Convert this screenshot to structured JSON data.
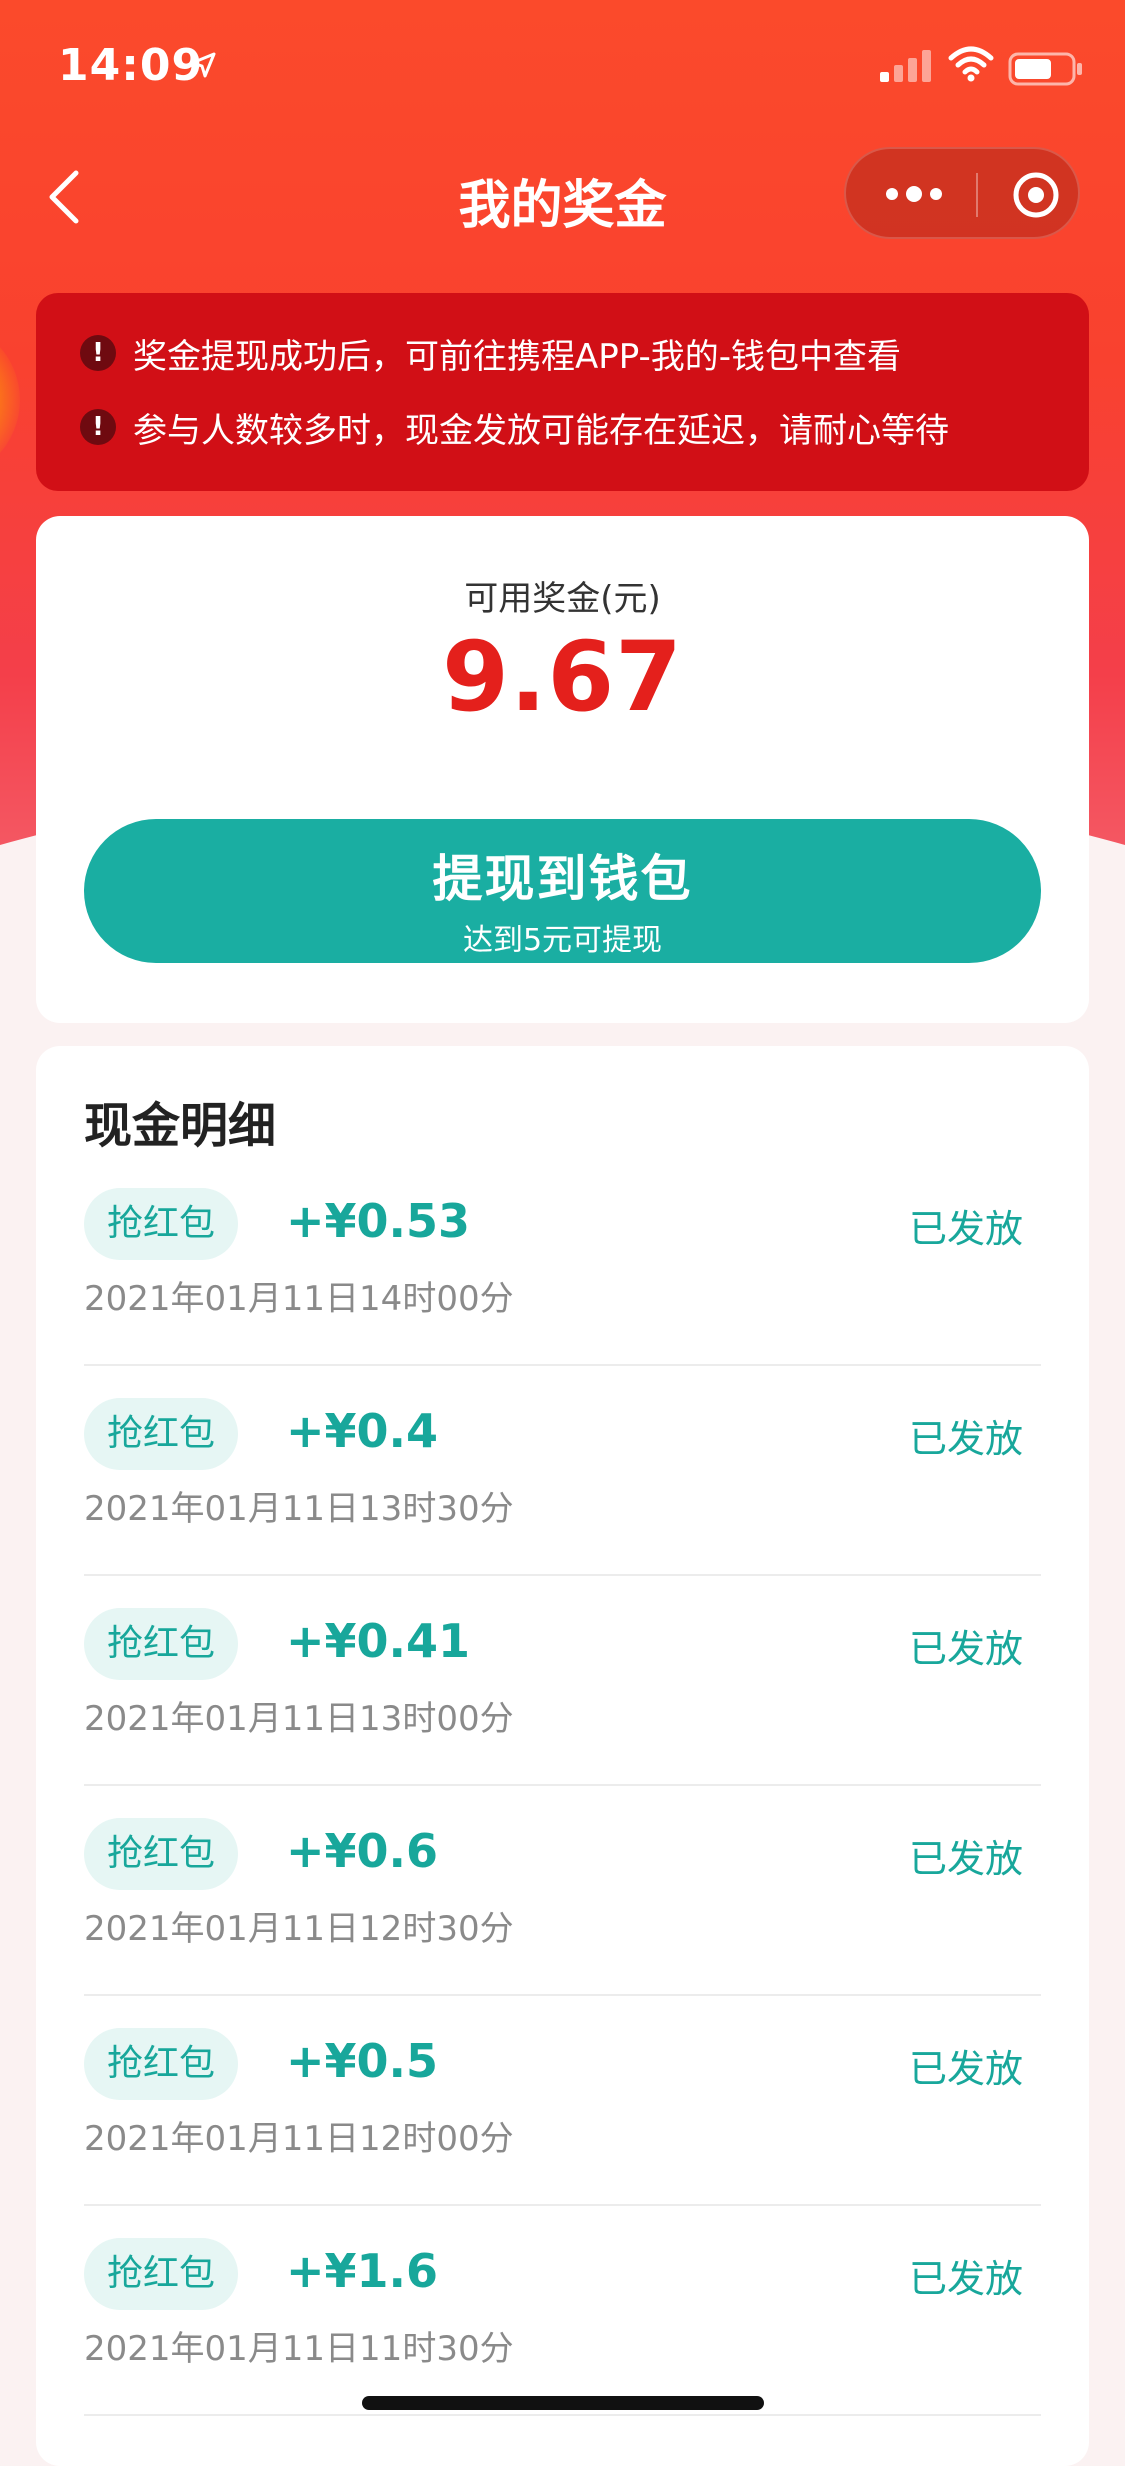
{
  "status_bar": {
    "time": "14:09"
  },
  "nav": {
    "title": "我的奖金"
  },
  "notices": [
    {
      "icon": "!",
      "text": "奖金提现成功后，可前往携程APP-我的-钱包中查看"
    },
    {
      "icon": "!",
      "text": "参与人数较多时，现金发放可能存在延迟，请耐心等待"
    }
  ],
  "balance": {
    "label": "可用奖金(元)",
    "amount": "9.67",
    "withdraw_label": "提现到钱包",
    "withdraw_sub": "达到5元可提现"
  },
  "details": {
    "title": "现金明细",
    "records": [
      {
        "tag": "抢红包",
        "amount": "+¥0.53",
        "status": "已发放",
        "date": "2021年01月11日14时00分"
      },
      {
        "tag": "抢红包",
        "amount": "+¥0.4",
        "status": "已发放",
        "date": "2021年01月11日13时30分"
      },
      {
        "tag": "抢红包",
        "amount": "+¥0.41",
        "status": "已发放",
        "date": "2021年01月11日13时00分"
      },
      {
        "tag": "抢红包",
        "amount": "+¥0.6",
        "status": "已发放",
        "date": "2021年01月11日12时30分"
      },
      {
        "tag": "抢红包",
        "amount": "+¥0.5",
        "status": "已发放",
        "date": "2021年01月11日12时00分"
      },
      {
        "tag": "抢红包",
        "amount": "+¥1.6",
        "status": "已发放",
        "date": "2021年01月11日11时30分"
      }
    ]
  },
  "colors": {
    "header": "#fb4a2b",
    "notice_bg": "#d10f16",
    "amount": "#e4201c",
    "accent": "#1aaea2"
  }
}
